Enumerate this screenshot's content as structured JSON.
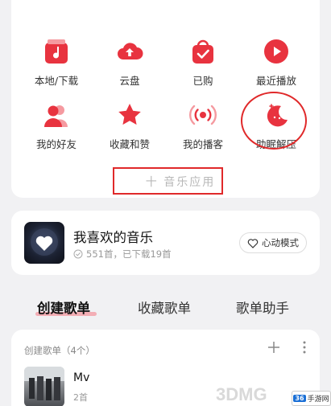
{
  "grid": [
    {
      "label": "本地/下载",
      "icon": "local-download-icon"
    },
    {
      "label": "云盘",
      "icon": "cloud-upload-icon"
    },
    {
      "label": "已购",
      "icon": "purchased-bag-icon"
    },
    {
      "label": "最近播放",
      "icon": "play-circle-icon"
    },
    {
      "label": "我的好友",
      "icon": "friends-icon"
    },
    {
      "label": "收藏和赞",
      "icon": "star-icon"
    },
    {
      "label": "我的播客",
      "icon": "broadcast-icon"
    },
    {
      "label": "助眠解压",
      "icon": "moon-icon"
    }
  ],
  "add_button": {
    "label": "十 音乐应用"
  },
  "favorites": {
    "title": "我喜欢的音乐",
    "subtitle": "551首，已下载19首",
    "heart_mode": "心动模式"
  },
  "tabs": [
    "创建歌单",
    "收藏歌单",
    "歌单助手"
  ],
  "playlist_section": {
    "header": "创建歌单（4个）",
    "items": [
      {
        "name": "Mv",
        "count": "2首"
      }
    ]
  },
  "watermark": {
    "text": "3DMG",
    "site": "36手游网"
  },
  "colors": {
    "accent": "#e8333f",
    "annotation": "#e0292a"
  }
}
